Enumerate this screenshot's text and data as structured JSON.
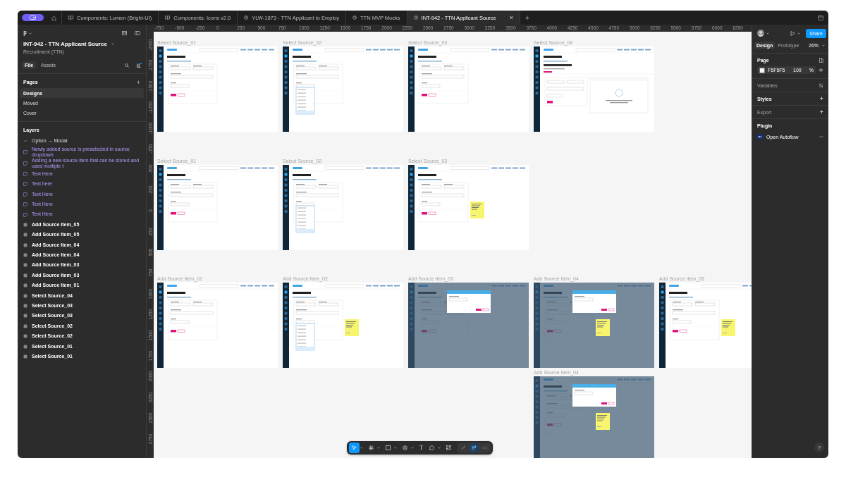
{
  "tab_bar": {
    "tabs": [
      {
        "label": "Components: Lumen (Bright-UI)",
        "kind": "library",
        "selected": false
      },
      {
        "label": "Components: Icons v2.0",
        "kind": "library",
        "selected": false
      },
      {
        "label": "YLW-1873 - TTN Applicant to Employ",
        "kind": "design",
        "selected": false
      },
      {
        "label": "TTN MVP Mocks",
        "kind": "design",
        "selected": false
      },
      {
        "label": "INT-942 - TTN Applicant Source",
        "kind": "design",
        "selected": true
      }
    ],
    "close": "×",
    "add": "+"
  },
  "left_panel": {
    "file_name": "INT-942 - TTN Applicant Source",
    "project": "Recruitment (TTN)",
    "tabs": [
      {
        "label": "File",
        "selected": true
      },
      {
        "label": "Assets",
        "selected": false
      }
    ],
    "pages_title": "Pages",
    "pages_add": "+",
    "pages": [
      {
        "label": "Designs",
        "selected": true
      },
      {
        "label": "Moved",
        "selected": false
      },
      {
        "label": "Cover",
        "selected": false
      }
    ],
    "layers_title": "Layers",
    "layers": [
      {
        "name": "Option → Modal",
        "kind": "connection"
      },
      {
        "name": "Newly added source is preselected in source dropdown",
        "kind": "sticky"
      },
      {
        "name": "Adding a new source item that can be stored and used multiple t",
        "kind": "sticky"
      },
      {
        "name": "Text Here",
        "kind": "sticky"
      },
      {
        "name": "Text here",
        "kind": "sticky"
      },
      {
        "name": "Text Here",
        "kind": "sticky"
      },
      {
        "name": "Text Here",
        "kind": "sticky"
      },
      {
        "name": "Text Here",
        "kind": "sticky"
      },
      {
        "name": "Add Source Item_05",
        "kind": "frame"
      },
      {
        "name": "Add Source Item_05",
        "kind": "frame"
      },
      {
        "name": "Add Source Item_04",
        "kind": "frame"
      },
      {
        "name": "Add Source Item_04",
        "kind": "frame"
      },
      {
        "name": "Add Source Item_03",
        "kind": "frame"
      },
      {
        "name": "Add Source Item_03",
        "kind": "frame"
      },
      {
        "name": "Add Source Item_01",
        "kind": "frame"
      },
      {
        "name": "Select Source_04",
        "kind": "frame"
      },
      {
        "name": "Select Source_03",
        "kind": "frame"
      },
      {
        "name": "Select Source_03",
        "kind": "frame"
      },
      {
        "name": "Select Source_02",
        "kind": "frame"
      },
      {
        "name": "Select Source_02",
        "kind": "frame"
      },
      {
        "name": "Select Source_01",
        "kind": "frame"
      },
      {
        "name": "Select Source_01",
        "kind": "frame"
      }
    ]
  },
  "canvas": {
    "top_ruler": [
      "-750",
      "-500",
      "-250",
      "0",
      "250",
      "500",
      "750",
      "1000",
      "1250",
      "1500",
      "1750",
      "2000",
      "2250",
      "2500",
      "2750",
      "3000",
      "3250",
      "3500",
      "3750",
      "4000",
      "4250",
      "4500",
      "4750",
      "5000",
      "5250",
      "5500",
      "5750",
      "6000",
      "6250"
    ],
    "side_ruler": [
      "-2000",
      "-1750",
      "-1500",
      "-1250",
      "-1000",
      "-750",
      "-500",
      "-250",
      "0",
      "250",
      "500",
      "750",
      "1000",
      "1250",
      "1500",
      "1750",
      "2000",
      "2250",
      "2500",
      "2750"
    ],
    "rows": [
      [
        {
          "label": "Select Source_01",
          "kind": "form",
          "dropdown_open": false,
          "modal_open": false,
          "sticky_note": false
        },
        {
          "label": "Select Source_02",
          "kind": "form",
          "dropdown_open": true,
          "modal_open": false,
          "sticky_note": false
        },
        {
          "label": "Select Source_03",
          "kind": "form",
          "dropdown_open": false,
          "modal_open": false,
          "sticky_note": false
        },
        {
          "label": "Select Source_04",
          "kind": "detail",
          "dropdown_open": false,
          "modal_open": false,
          "sticky_note": false
        }
      ],
      [
        {
          "label": "Select Source_01",
          "kind": "form",
          "dropdown_open": false,
          "modal_open": false,
          "sticky_note": false
        },
        {
          "label": "Select Source_02",
          "kind": "form",
          "dropdown_open": true,
          "modal_open": false,
          "sticky_note": false
        },
        {
          "label": "Select Source_03",
          "kind": "form",
          "dropdown_open": false,
          "modal_open": false,
          "sticky_note": true
        }
      ],
      [
        {
          "label": "Add Source Item_01",
          "kind": "form",
          "dropdown_open": false,
          "modal_open": false,
          "sticky_note": false
        },
        {
          "label": "Add Source Item_02",
          "kind": "form",
          "dropdown_open": true,
          "modal_open": false,
          "sticky_note": true
        },
        {
          "label": "Add Source Item_03",
          "kind": "form",
          "dropdown_open": false,
          "modal_open": true,
          "sticky_note": false
        },
        {
          "label": "Add Source Item_04",
          "kind": "form",
          "dropdown_open": false,
          "modal_open": true,
          "sticky_note": true
        },
        {
          "label": "Add Source Item_05",
          "kind": "form",
          "dropdown_open": false,
          "modal_open": false,
          "sticky_note": true
        }
      ],
      [
        "",
        "",
        "",
        {
          "label": "Add Source Item_04",
          "kind": "form",
          "dropdown_open": false,
          "modal_open": true,
          "sticky_note": true
        }
      ]
    ]
  },
  "right_panel": {
    "share": "Share",
    "tabs": [
      {
        "label": "Design",
        "selected": true
      },
      {
        "label": "Prototype",
        "selected": false
      }
    ],
    "zoom": "26%",
    "page_title": "Page",
    "color": {
      "hex": "F5F5F5",
      "opacity": "100",
      "unit": "%"
    },
    "sections": [
      {
        "title": "Variables",
        "kind": "variables",
        "disabled": true
      },
      {
        "title": "Styles",
        "kind": "add",
        "disabled": false,
        "action": "+"
      },
      {
        "title": "Export",
        "kind": "add",
        "disabled": true,
        "action": "+"
      }
    ],
    "plugin_title": "Plugin",
    "plugins": [
      {
        "name": "Open Autoflow"
      }
    ],
    "help": "?"
  },
  "toolbar": {
    "tools": [
      {
        "kind": "move",
        "selected": true,
        "menu": true
      },
      {
        "kind": "frame",
        "selected": false,
        "menu": true
      },
      {
        "kind": "shape",
        "selected": false,
        "menu": true
      },
      {
        "kind": "pen",
        "selected": false,
        "menu": true
      },
      {
        "kind": "text",
        "selected": false,
        "menu": false,
        "glyph": "T"
      },
      {
        "kind": "comment",
        "selected": false,
        "menu": true
      },
      {
        "kind": "actions",
        "selected": false,
        "menu": false
      }
    ],
    "modes": [
      {
        "kind": "draw",
        "selected": false
      },
      {
        "kind": "design",
        "selected": true
      },
      {
        "kind": "dev",
        "selected": false
      }
    ]
  }
}
